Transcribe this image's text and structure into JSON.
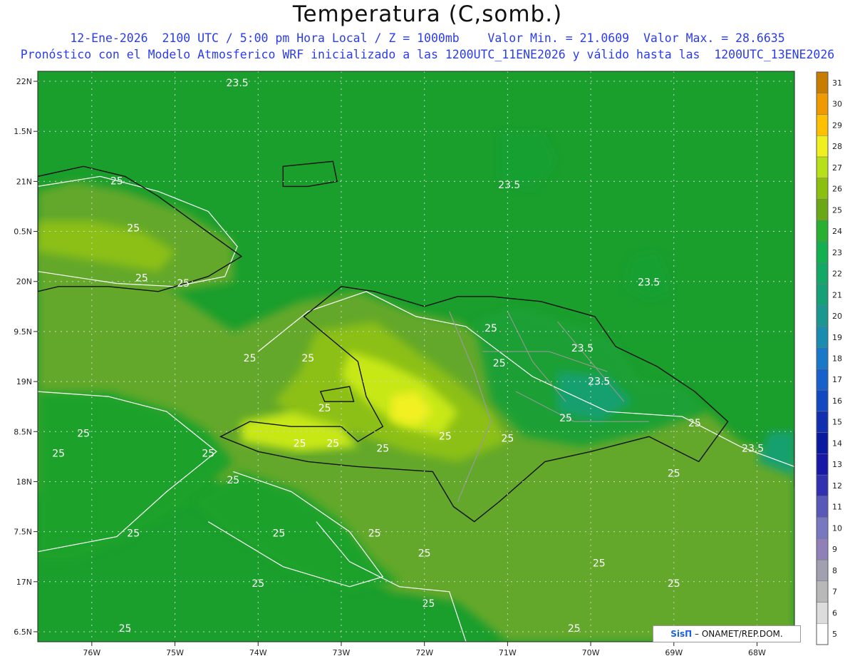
{
  "title": "Temperatura (C,somb.)",
  "subtitle_1": "12-Ene-2026  2100 UTC / 5:00 pm Hora Local / Z = 1000mb    Valor Min. = 21.0609  Valor Max. = 28.6635",
  "subtitle_2": "Pronóstico con el Modelo Atmosferico WRF inicializado a las 1200UTC_11ENE2026 y válido hasta las  1200UTC_13ENE2026",
  "credit": {
    "brand": "SisΠ",
    "text": " – ONAMET/REP.DOM."
  },
  "map": {
    "lat_labels": [
      "22N",
      "1.5N",
      "21N",
      "0.5N",
      "20N",
      "9.5N",
      "19N",
      "8.5N",
      "18N",
      "7.5N",
      "17N",
      "6.5N"
    ],
    "lon_labels": [
      "76W",
      "75W",
      "74W",
      "73W",
      "72W",
      "71W",
      "70W",
      "69W",
      "68W"
    ],
    "lon_range": [
      -76.65,
      -67.55
    ],
    "lat_range": [
      16.4,
      22.1
    ],
    "contour_labels": [
      {
        "text": "23.5",
        "lon": -74.25,
        "lat": 21.95
      },
      {
        "text": "25",
        "lon": -75.7,
        "lat": 20.97
      },
      {
        "text": "25",
        "lon": -75.5,
        "lat": 20.5
      },
      {
        "text": "25",
        "lon": -75.4,
        "lat": 20.0
      },
      {
        "text": "25",
        "lon": -74.9,
        "lat": 19.95
      },
      {
        "text": "23.5",
        "lon": -70.98,
        "lat": 20.93
      },
      {
        "text": "23.5",
        "lon": -69.3,
        "lat": 19.96
      },
      {
        "text": "25",
        "lon": -71.2,
        "lat": 19.5
      },
      {
        "text": "23.5",
        "lon": -70.1,
        "lat": 19.3
      },
      {
        "text": "23.5",
        "lon": -69.9,
        "lat": 18.97
      },
      {
        "text": "25",
        "lon": -74.1,
        "lat": 19.2
      },
      {
        "text": "25",
        "lon": -73.4,
        "lat": 19.2
      },
      {
        "text": "25",
        "lon": -71.1,
        "lat": 19.15
      },
      {
        "text": "25",
        "lon": -73.2,
        "lat": 18.7
      },
      {
        "text": "25",
        "lon": -70.3,
        "lat": 18.6
      },
      {
        "text": "25",
        "lon": -68.75,
        "lat": 18.55
      },
      {
        "text": "25",
        "lon": -76.1,
        "lat": 18.45
      },
      {
        "text": "25",
        "lon": -76.4,
        "lat": 18.25
      },
      {
        "text": "25",
        "lon": -74.6,
        "lat": 18.25
      },
      {
        "text": "25",
        "lon": -73.5,
        "lat": 18.35
      },
      {
        "text": "25",
        "lon": -73.1,
        "lat": 18.35
      },
      {
        "text": "25",
        "lon": -72.5,
        "lat": 18.3
      },
      {
        "text": "25",
        "lon": -71.75,
        "lat": 18.42
      },
      {
        "text": "25",
        "lon": -71.0,
        "lat": 18.4
      },
      {
        "text": "23.5",
        "lon": -68.05,
        "lat": 18.3
      },
      {
        "text": "25",
        "lon": -69.0,
        "lat": 18.05
      },
      {
        "text": "25",
        "lon": -74.3,
        "lat": 17.98
      },
      {
        "text": "25",
        "lon": -75.5,
        "lat": 17.45
      },
      {
        "text": "25",
        "lon": -73.75,
        "lat": 17.45
      },
      {
        "text": "25",
        "lon": -72.6,
        "lat": 17.45
      },
      {
        "text": "25",
        "lon": -72.0,
        "lat": 17.25
      },
      {
        "text": "25",
        "lon": -69.9,
        "lat": 17.15
      },
      {
        "text": "25",
        "lon": -74.0,
        "lat": 16.95
      },
      {
        "text": "25",
        "lon": -71.95,
        "lat": 16.75
      },
      {
        "text": "25",
        "lon": -69.0,
        "lat": 16.95
      },
      {
        "text": "25",
        "lon": -75.6,
        "lat": 16.5
      },
      {
        "text": "25",
        "lon": -70.2,
        "lat": 16.5
      }
    ]
  },
  "colorbar": {
    "levels": [
      "5",
      "6",
      "7",
      "8",
      "9",
      "10",
      "11",
      "12",
      "13",
      "14",
      "15",
      "16",
      "17",
      "18",
      "19",
      "20",
      "21",
      "22",
      "23",
      "24",
      "25",
      "26",
      "27",
      "28",
      "29",
      "30",
      "31"
    ],
    "colors": [
      "#ffffff",
      "#dcdcdc",
      "#b8b8b8",
      "#a0a0b0",
      "#9080b8",
      "#7878c0",
      "#5858b8",
      "#3030b0",
      "#1818a8",
      "#0a1aa0",
      "#1030b0",
      "#1248c0",
      "#1860cc",
      "#1a78c8",
      "#1a8cb0",
      "#1a9890",
      "#16a078",
      "#14a866",
      "#12b050",
      "#28b030",
      "#6aa816",
      "#8cc010",
      "#b8e018",
      "#f0f020",
      "#ffc000",
      "#ee9a00",
      "#c87c00"
    ]
  },
  "field_colors": {
    "base": "#64a82a",
    "sea_dark": "#1aa02e",
    "light": "#8cc012",
    "warm": "#c8e818",
    "yellow": "#f2f020",
    "cool": "#14a070"
  }
}
